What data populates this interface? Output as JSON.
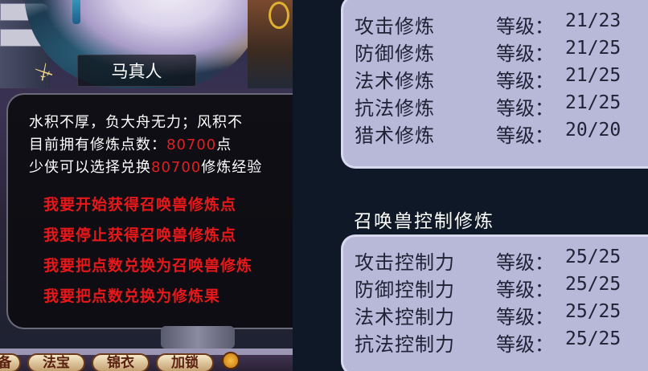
{
  "npc": {
    "name": "马真人"
  },
  "dialog": {
    "line1": "水积不厚，负大舟无力；风积不",
    "line2_prefix": "目前拥有修炼点数：",
    "line2_num": "80700",
    "line2_suffix": "点",
    "line3_prefix": "少侠可以选择兑换",
    "line3_num": "80700",
    "line3_suffix": "修炼经验"
  },
  "options": [
    "我要开始获得召唤兽修炼点",
    "我要停止获得召唤兽修炼点",
    "我要把点数兑换为召唤兽修炼",
    "我要把点数兑换为修炼果"
  ],
  "bottom_buttons": [
    "备",
    "法宝",
    "锦衣",
    "加锁"
  ],
  "cultivation": {
    "label": "等级：",
    "rows": [
      {
        "name": "攻击修炼",
        "value": "21/23"
      },
      {
        "name": "防御修炼",
        "value": "21/25"
      },
      {
        "name": "法术修炼",
        "value": "21/25"
      },
      {
        "name": "抗法修炼",
        "value": "21/25"
      },
      {
        "name": "猎术修炼",
        "value": "20/20"
      }
    ]
  },
  "control": {
    "title": "召唤兽控制修炼",
    "label": "等级：",
    "rows": [
      {
        "name": "攻击控制力",
        "value": "25/25"
      },
      {
        "name": "防御控制力",
        "value": "25/25"
      },
      {
        "name": "法术控制力",
        "value": "25/25"
      },
      {
        "name": "抗法控制力",
        "value": "25/25"
      }
    ]
  }
}
